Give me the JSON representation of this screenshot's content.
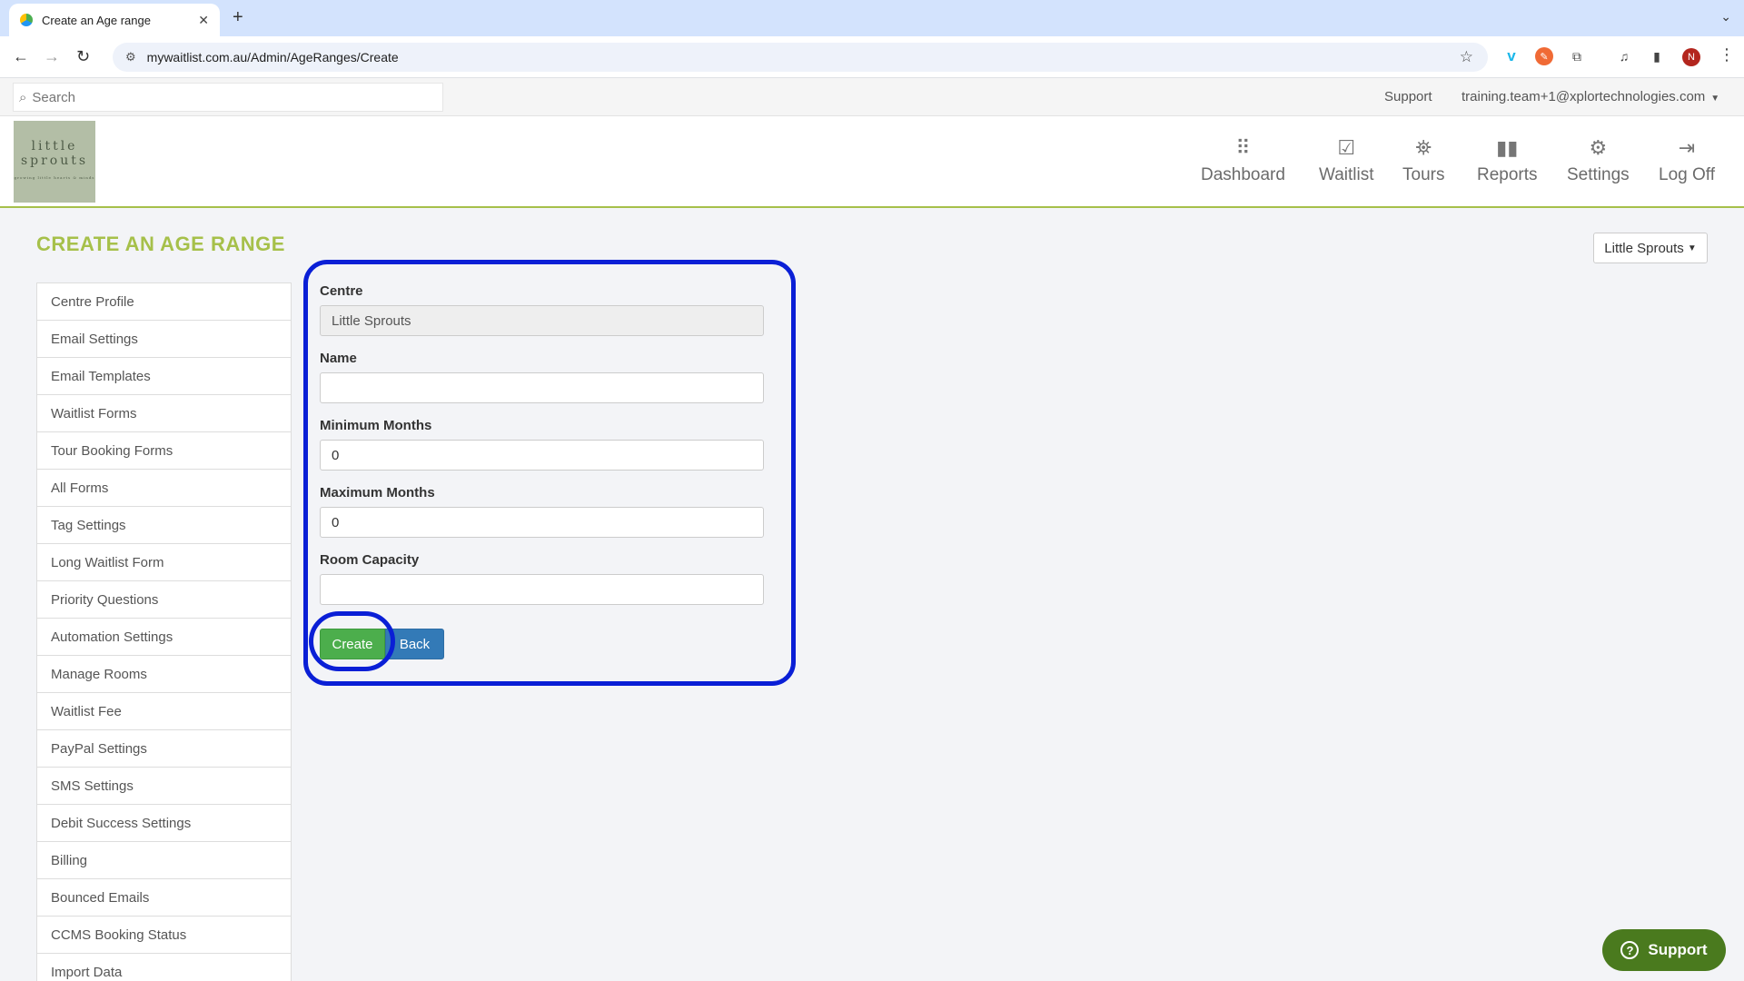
{
  "browser": {
    "tab_title": "Create an Age range",
    "tab_close": "✕",
    "new_tab": "+",
    "tab_menu": "⌄",
    "url": "mywaitlist.com.au/Admin/AgeRanges/Create",
    "avatar_letter": "N",
    "icons": [
      "back-arrow-icon",
      "forward-arrow-icon",
      "reload-icon",
      "site-settings-icon",
      "bookmark-star-icon",
      "vimeo-extension-icon",
      "orange-extension-icon",
      "extensions-puzzle-icon",
      "media-control-icon",
      "side-panel-icon",
      "profile-avatar",
      "chrome-menu-icon"
    ]
  },
  "topbar": {
    "search_placeholder": "Search",
    "support_label": "Support",
    "user_email": "training.team+1@xplortechnologies.com"
  },
  "logo": {
    "line1": "little",
    "line2": "sprouts",
    "tagline": "growing little hearts & minds"
  },
  "nav": [
    {
      "label": "Dashboard",
      "icon": "dashboard-grid-icon"
    },
    {
      "label": "Waitlist",
      "icon": "inbox-check-icon"
    },
    {
      "label": "Tours",
      "icon": "map-marker-icon"
    },
    {
      "label": "Reports",
      "icon": "bar-chart-icon"
    },
    {
      "label": "Settings",
      "icon": "gear-icon"
    },
    {
      "label": "Log Off",
      "icon": "sign-out-icon"
    }
  ],
  "page": {
    "title": "CREATE AN AGE RANGE",
    "centre_selector": "Little Sprouts"
  },
  "sidebar": {
    "items": [
      "Centre Profile",
      "Email Settings",
      "Email Templates",
      "Waitlist Forms",
      "Tour Booking Forms",
      "All Forms",
      "Tag Settings",
      "Long Waitlist Form",
      "Priority Questions",
      "Automation Settings",
      "Manage Rooms",
      "Waitlist Fee",
      "PayPal Settings",
      "SMS Settings",
      "Debit Success Settings",
      "Billing",
      "Bounced Emails",
      "CCMS Booking Status",
      "Import Data"
    ]
  },
  "form": {
    "centre_label": "Centre",
    "centre_value": "Little Sprouts",
    "name_label": "Name",
    "name_value": "",
    "min_label": "Minimum Months",
    "min_value": "0",
    "max_label": "Maximum Months",
    "max_value": "0",
    "capacity_label": "Room Capacity",
    "capacity_value": "",
    "create_label": "Create",
    "back_label": "Back"
  },
  "support_widget": {
    "label": "Support"
  },
  "colors": {
    "accent_green": "#a6c04a",
    "highlight_blue": "#0a1fd6",
    "create_green": "#4cae4c",
    "back_blue": "#337ab7",
    "support_widget": "#4a7a1e"
  }
}
